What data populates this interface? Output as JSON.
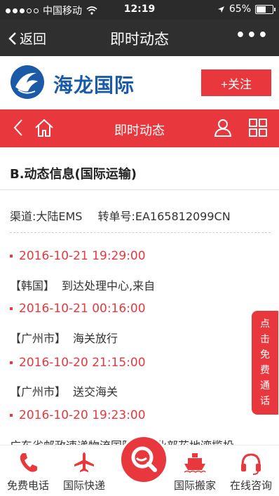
{
  "status": {
    "carrier": "中国移动",
    "time": "12:19",
    "battery": "65%",
    "battery_level": 0.65
  },
  "nav": {
    "back_label": "返回",
    "title": "即时动态",
    "more_label": "•••"
  },
  "brand": {
    "name": "海龙国际",
    "follow_label": "+关注"
  },
  "subbar": {
    "title": "即时动态"
  },
  "content": {
    "section_title": "B.动态信息(国际运输)",
    "channel_label": "渠道:大陆EMS",
    "tracking_label": "转单号:EA165812099CN",
    "events": [
      {
        "time": "2016-10-21 19:29:00",
        "place": "【韩国】",
        "desc": "到达处理中心,来自"
      },
      {
        "time": "2016-10-21 00:16:00",
        "place": "【广州市】",
        "desc": "海关放行"
      },
      {
        "time": "2016-10-20 21:15:00",
        "place": "【广州市】",
        "desc": "送交海关"
      },
      {
        "time": "2016-10-20 19:23:00",
        "place": "",
        "desc": ""
      }
    ],
    "cut_text": "广东省邮政速递物流国际…营业部花地湾揽投"
  },
  "float_tab": {
    "label": "点击免费通话"
  },
  "bottom": {
    "tabs": [
      {
        "label": "免费电话",
        "icon": "phone-icon"
      },
      {
        "label": "国际快递",
        "icon": "plane-icon"
      },
      {
        "label": "",
        "icon": "search-icon"
      },
      {
        "label": "国际搬家",
        "icon": "ship-icon"
      },
      {
        "label": "在线咨询",
        "icon": "headset-icon"
      }
    ]
  },
  "colors": {
    "accent": "#e8383d",
    "brand_blue": "#1b5aa6",
    "dark_bar": "#2f2f2f"
  }
}
